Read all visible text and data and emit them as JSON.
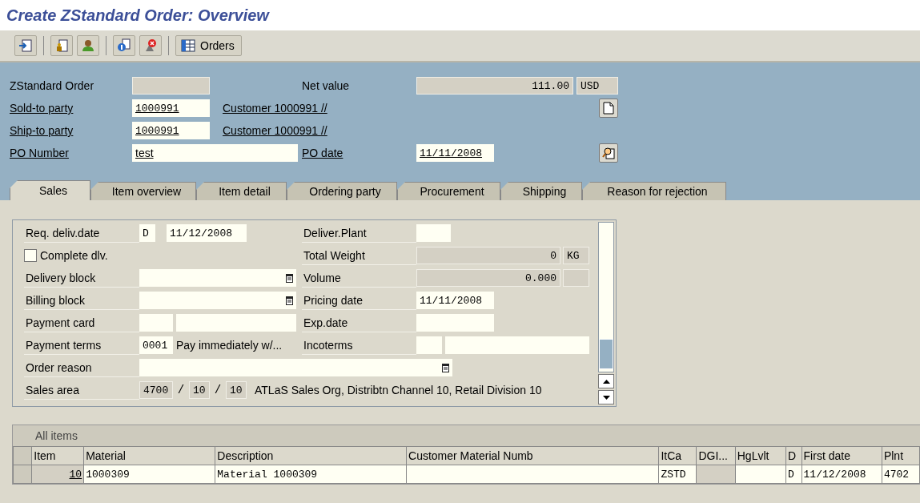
{
  "title": "Create ZStandard Order: Overview",
  "toolbar": {
    "orders_label": "Orders"
  },
  "header": {
    "order_type": "ZStandard Order",
    "net_value_label": "Net value",
    "net_value": "111.00",
    "currency": "USD",
    "sold_to": {
      "label": "Sold-to party",
      "number": "1000991",
      "name": "Customer 1000991 //"
    },
    "ship_to": {
      "label": "Ship-to party",
      "number": "1000991",
      "name": "Customer 1000991 //"
    },
    "po_number": {
      "label": "PO Number",
      "value": "test"
    },
    "po_date": {
      "label": "PO date",
      "value": "11/11/2008"
    }
  },
  "tabs": [
    {
      "label": "Sales",
      "selected": true
    },
    {
      "label": "Item overview",
      "selected": false
    },
    {
      "label": "Item detail",
      "selected": false
    },
    {
      "label": "Ordering party",
      "selected": false
    },
    {
      "label": "Procurement",
      "selected": false
    },
    {
      "label": "Shipping",
      "selected": false
    },
    {
      "label": "Reason for rejection",
      "selected": false
    }
  ],
  "sales": {
    "req_deliv": {
      "label": "Req. deliv.date",
      "format": "D",
      "date": "11/12/2008"
    },
    "complete_dlv": {
      "label": "Complete dlv.",
      "checked": false
    },
    "delivery_block": {
      "label": "Delivery block"
    },
    "billing_block": {
      "label": "Billing block"
    },
    "payment_card": {
      "label": "Payment card"
    },
    "payment_terms": {
      "label": "Payment terms",
      "code": "0001",
      "text": "Pay immediately w/..."
    },
    "order_reason": {
      "label": "Order reason"
    },
    "sales_area": {
      "label": "Sales area",
      "org": "4700",
      "separators": [
        "/",
        "/"
      ],
      "channel": "10",
      "division": "10",
      "text": "ATLaS Sales Org, Distribtn Channel 10, Retail Division 10"
    },
    "deliver_plant": {
      "label": "Deliver.Plant"
    },
    "total_weight": {
      "label": "Total Weight",
      "value": "0",
      "unit": "KG"
    },
    "volume": {
      "label": "Volume",
      "value": "0.000"
    },
    "pricing_date": {
      "label": "Pricing date",
      "value": "11/11/2008"
    },
    "exp_date": {
      "label": "Exp.date"
    },
    "incoterms": {
      "label": "Incoterms"
    }
  },
  "items": {
    "title": "All items",
    "columns": [
      "Item",
      "Material",
      "Description",
      "Customer Material Numb",
      "ItCa",
      "DGI...",
      "HgLvlt",
      "D",
      "First date",
      "Plnt"
    ],
    "rows": [
      [
        "10",
        "1000309",
        "Material 1000309",
        null,
        "ZSTD",
        null,
        null,
        "D",
        "11/12/2008",
        "4702"
      ]
    ]
  }
}
